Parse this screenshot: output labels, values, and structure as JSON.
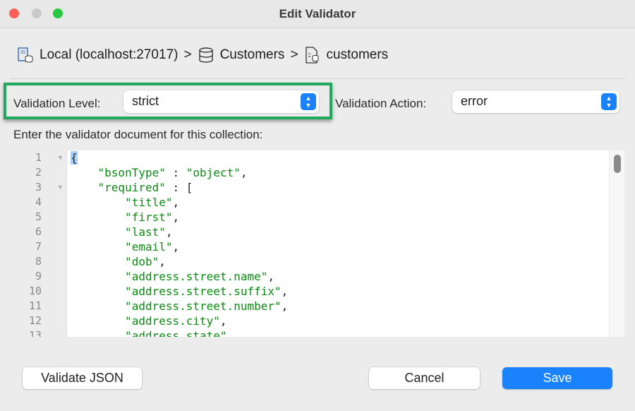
{
  "window": {
    "title": "Edit Validator"
  },
  "breadcrumb": {
    "connection": "Local (localhost:27017)",
    "database": "Customers",
    "collection": "customers",
    "separator": ">"
  },
  "validation_level": {
    "label": "Validation Level:",
    "value": "strict"
  },
  "validation_action": {
    "label": "Validation Action:",
    "value": "error"
  },
  "instructions": "Enter the validator document for this collection:",
  "editor": {
    "lines": [
      [
        [
          "p",
          "{"
        ]
      ],
      [
        [
          "p",
          "    "
        ],
        [
          "s",
          "\"bsonType\""
        ],
        [
          "p",
          " : "
        ],
        [
          "s",
          "\"object\""
        ],
        [
          "p",
          ","
        ]
      ],
      [
        [
          "p",
          "    "
        ],
        [
          "s",
          "\"required\""
        ],
        [
          "p",
          " : ["
        ]
      ],
      [
        [
          "p",
          "        "
        ],
        [
          "s",
          "\"title\""
        ],
        [
          "p",
          ","
        ]
      ],
      [
        [
          "p",
          "        "
        ],
        [
          "s",
          "\"first\""
        ],
        [
          "p",
          ","
        ]
      ],
      [
        [
          "p",
          "        "
        ],
        [
          "s",
          "\"last\""
        ],
        [
          "p",
          ","
        ]
      ],
      [
        [
          "p",
          "        "
        ],
        [
          "s",
          "\"email\""
        ],
        [
          "p",
          ","
        ]
      ],
      [
        [
          "p",
          "        "
        ],
        [
          "s",
          "\"dob\""
        ],
        [
          "p",
          ","
        ]
      ],
      [
        [
          "p",
          "        "
        ],
        [
          "s",
          "\"address.street.name\""
        ],
        [
          "p",
          ","
        ]
      ],
      [
        [
          "p",
          "        "
        ],
        [
          "s",
          "\"address.street.suffix\""
        ],
        [
          "p",
          ","
        ]
      ],
      [
        [
          "p",
          "        "
        ],
        [
          "s",
          "\"address.street.number\""
        ],
        [
          "p",
          ","
        ]
      ],
      [
        [
          "p",
          "        "
        ],
        [
          "s",
          "\"address.city\""
        ],
        [
          "p",
          ","
        ]
      ],
      [
        [
          "p",
          "        "
        ],
        [
          "s",
          "\"address.state\""
        ],
        [
          "p",
          ","
        ]
      ]
    ],
    "folds": [
      1,
      3
    ]
  },
  "buttons": {
    "validate": "Validate JSON",
    "cancel": "Cancel",
    "save": "Save"
  },
  "colors": {
    "accent": "#1a82fb",
    "highlight": "#20a95a",
    "string": "#0b8a12"
  }
}
